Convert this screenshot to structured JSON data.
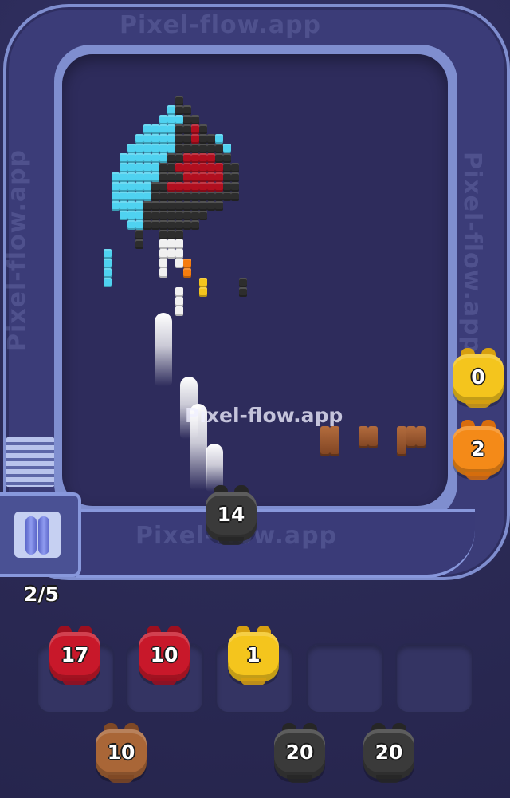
{
  "watermark_text": "Pixel-flow.app",
  "overlay_watermark": "Pixel-flow.app",
  "level_progress": "2/5",
  "active_shooter": {
    "count": "14"
  },
  "side_queue": [
    {
      "count": "0",
      "color": "#f4c51d"
    },
    {
      "count": "2",
      "color": "#f48a18"
    }
  ],
  "tray": [
    {
      "count": "17",
      "color": "#c8182a"
    },
    {
      "count": "10",
      "color": "#c8182a"
    },
    {
      "count": "1",
      "color": "#f4c51d"
    },
    {
      "count": "",
      "color": "empty"
    },
    {
      "count": "",
      "color": "empty"
    }
  ],
  "bottom_queue": [
    {
      "count": "10",
      "color": "#a96637"
    },
    {
      "count": "20",
      "color": "#3a3a3a"
    },
    {
      "count": "20",
      "color": "#3a3a3a"
    }
  ]
}
